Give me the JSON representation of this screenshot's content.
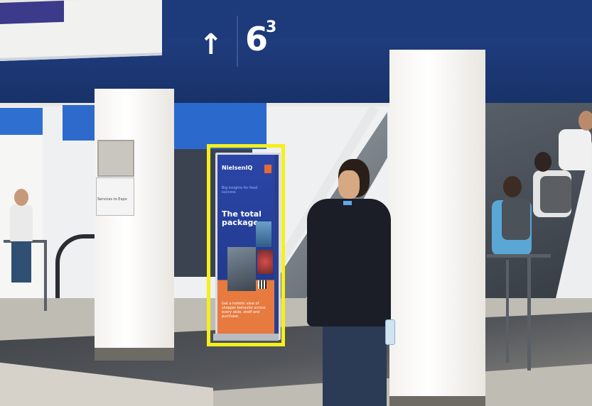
{
  "sign": {
    "arrow": "↑",
    "hall_number": "6",
    "hall_superscript": "3"
  },
  "info_sign": {
    "text": "Services to Expo"
  },
  "display": {
    "brand": "NielsenIQ",
    "subheading": "Big insights for food success",
    "headline": "The total package.",
    "footer": "Get a holistic view of shopper behavior across every aisle, shelf and purchase."
  },
  "colors": {
    "sign_band": "#1d3a7a",
    "highlight": "#f4f01c",
    "display_blue": "#2b46a8",
    "display_orange": "#e77a3f"
  }
}
